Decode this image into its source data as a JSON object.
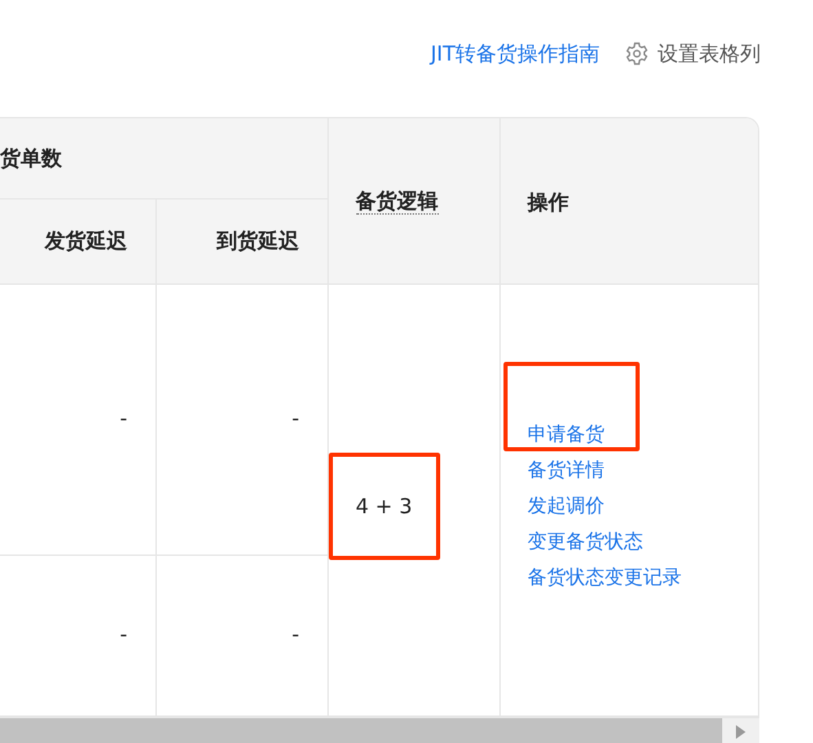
{
  "toolbar": {
    "guide_link": "JIT转备货操作指南",
    "column_settings": "设置表格列"
  },
  "table": {
    "group_header": "货单数",
    "columns": [
      "发货延迟",
      "到货延迟"
    ],
    "logic_header": "备货逻辑",
    "actions_header": "操作",
    "rows": [
      {
        "cells": [
          "-",
          "-"
        ]
      },
      {
        "cells": [
          "-",
          "-"
        ]
      }
    ],
    "logic": {
      "text": "4 + 3",
      "highlighted": true
    },
    "actions": [
      {
        "label": "申请备货",
        "highlighted": true
      },
      {
        "label": "备货详情",
        "highlighted": false
      },
      {
        "label": "发起调价",
        "highlighted": false
      },
      {
        "label": "变更备货状态",
        "highlighted": false
      },
      {
        "label": "备货状态变更记录",
        "highlighted": false
      }
    ]
  }
}
